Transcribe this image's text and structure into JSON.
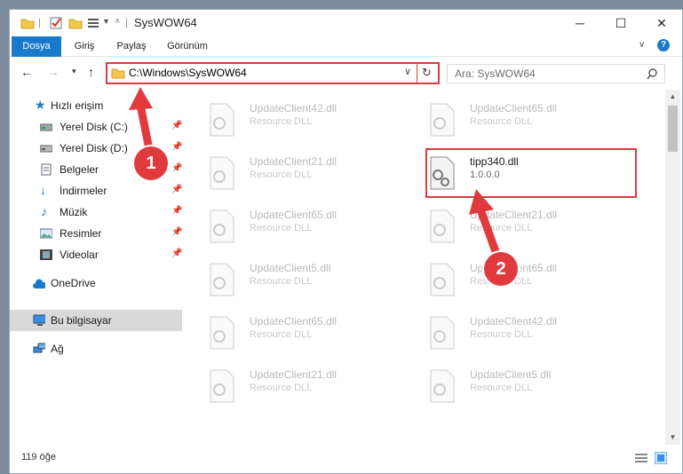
{
  "window": {
    "title": "SysWOW64",
    "controls": {
      "minimize": "─",
      "maximize": "☐",
      "close": "✕"
    }
  },
  "ribbon": {
    "tabs": [
      "Dosya",
      "Giriş",
      "Paylaş",
      "Görünüm"
    ],
    "help": "?"
  },
  "address": {
    "path": "C:\\Windows\\SysWOW64",
    "search_placeholder": "Ara: SysWOW64"
  },
  "sidebar": {
    "items": [
      {
        "label": "Hızlı erişim",
        "icon": "star-icon"
      },
      {
        "label": "Yerel Disk (C:)",
        "icon": "drive-icon",
        "pinned": true
      },
      {
        "label": "Yerel Disk (D:)",
        "icon": "drive-icon",
        "pinned": true
      },
      {
        "label": "Belgeler",
        "icon": "documents-icon",
        "pinned": true
      },
      {
        "label": "İndirmeler",
        "icon": "download-icon",
        "pinned": true
      },
      {
        "label": "Müzik",
        "icon": "music-icon",
        "pinned": true
      },
      {
        "label": "Resimler",
        "icon": "pictures-icon",
        "pinned": true
      },
      {
        "label": "Videolar",
        "icon": "videos-icon",
        "pinned": true
      },
      {
        "label": "OneDrive",
        "icon": "cloud-icon"
      },
      {
        "label": "Bu bilgisayar",
        "icon": "computer-icon"
      },
      {
        "label": "Ağ",
        "icon": "network-icon"
      }
    ]
  },
  "files": [
    {
      "name": "UpdateClient42.dll",
      "type": "Resource DLL"
    },
    {
      "name": "UpdateClient65.dll",
      "type": "Resource DLL"
    },
    {
      "name": "UpdateClient21.dll",
      "type": "Resource DLL"
    },
    {
      "name": "tipp340.dll",
      "type": "1.0.0.0"
    },
    {
      "name": "UpdateClient65.dll",
      "type": "Resource DLL"
    },
    {
      "name": "UpdateClient21.dll",
      "type": "Resource DLL"
    },
    {
      "name": "UpdateClient5.dll",
      "type": "Resource DLL"
    },
    {
      "name": "UpdateClient65.dll",
      "type": "Resource DLL"
    },
    {
      "name": "UpdateClient65.dll",
      "type": "Resource DLL"
    },
    {
      "name": "UpdateClient42.dll",
      "type": "Resource DLL"
    },
    {
      "name": "UpdateClient21.dll",
      "type": "Resource DLL"
    },
    {
      "name": "UpdateClient5.dll",
      "type": "Resource DLL"
    }
  ],
  "status": {
    "count": "119 öğe"
  },
  "callouts": [
    "1",
    "2"
  ],
  "colors": {
    "accent": "#1979ca",
    "highlight": "#e0393e"
  }
}
